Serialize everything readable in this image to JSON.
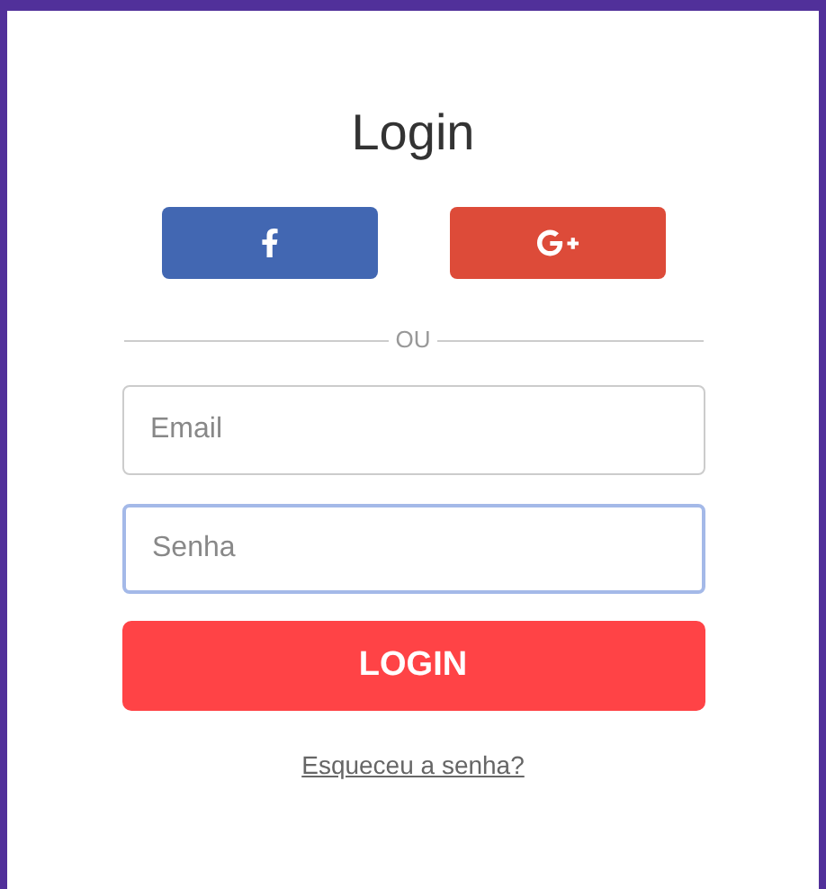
{
  "title": "Login",
  "social_buttons": [
    {
      "kind": "facebook"
    },
    {
      "kind": "google"
    }
  ],
  "divider": "OU",
  "fields": [
    {
      "placeholder": "Email",
      "focused": false
    },
    {
      "placeholder": "Senha",
      "focused": true
    }
  ],
  "submit": "LOGIN",
  "forgot_link": "Esqueceu a senha?"
}
